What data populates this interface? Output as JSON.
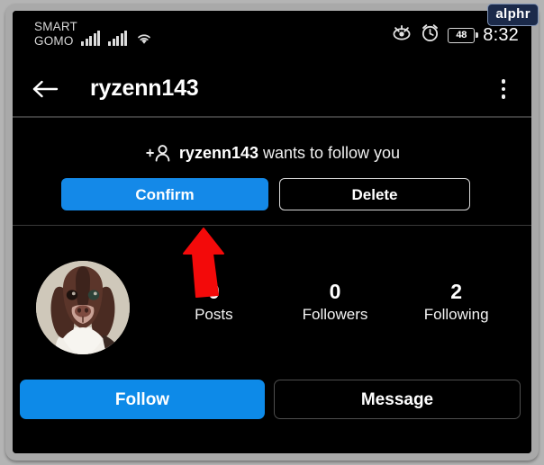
{
  "watermark": {
    "label": "alphr"
  },
  "status_bar": {
    "carrier_line1": "SMART",
    "carrier_line2": "GOMO",
    "signal_icon_1": "signal-bars-icon",
    "signal_icon_2": "signal-bars-icon",
    "wifi_icon": "wifi-icon",
    "eye_comfort_icon": "eye-off-icon",
    "alarm_icon": "alarm-clock-icon",
    "battery_level": "48",
    "time": "8:32"
  },
  "app_bar": {
    "back_icon": "back-arrow-icon",
    "title": "ryzenn143",
    "overflow_icon": "three-dot-menu-icon"
  },
  "follow_request": {
    "add_person_icon": "add-person-icon",
    "plus": "+",
    "username": "ryzenn143",
    "message": "wants to follow you",
    "confirm_label": "Confirm",
    "delete_label": "Delete"
  },
  "profile": {
    "avatar_alt": "dog-profile-photo",
    "stats": [
      {
        "value": "0",
        "label": "Posts"
      },
      {
        "value": "0",
        "label": "Followers"
      },
      {
        "value": "2",
        "label": "Following"
      }
    ]
  },
  "actions": {
    "follow_label": "Follow",
    "message_label": "Message"
  },
  "annotation": {
    "arrow_icon": "red-arrow-annotation",
    "arrow_color": "#F30A0A"
  },
  "colors": {
    "accent_blue": "#1489E8",
    "follow_blue": "#0D8AE8",
    "screen_background": "#000000",
    "divider": "#3A3A3A",
    "frame": "#A9A9A9",
    "watermark_bg": "#1B2A4A"
  }
}
